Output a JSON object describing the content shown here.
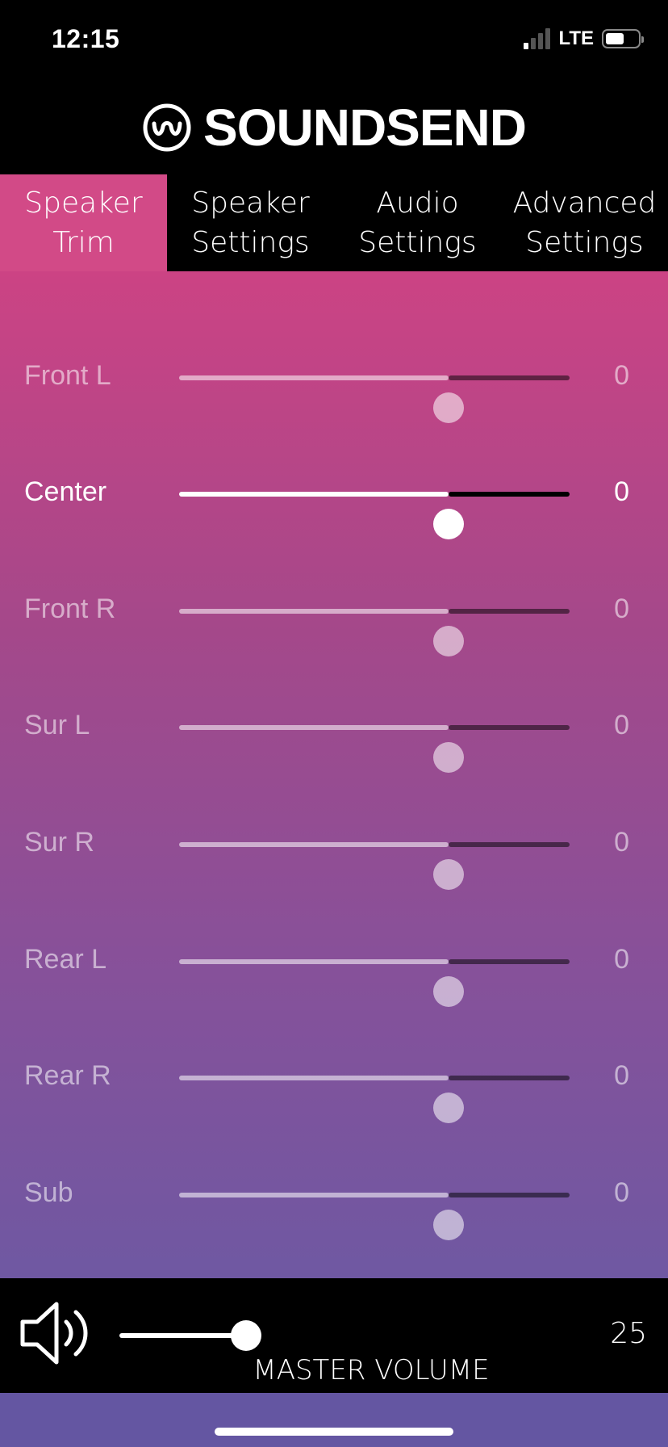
{
  "status_bar": {
    "time": "12:15",
    "network": "LTE",
    "signal_bars": 1,
    "battery_level": 0.5
  },
  "app": {
    "logo_text": "SOUNDSEND",
    "icon": "wave-circle-icon"
  },
  "tabs": [
    {
      "label": "Speaker\nTrim",
      "active": true
    },
    {
      "label": "Speaker\nSettings",
      "active": false
    },
    {
      "label": "Audio\nSettings",
      "active": false
    },
    {
      "label": "Advanced\nSettings",
      "active": false
    }
  ],
  "trims": [
    {
      "label": "Front L",
      "value": "0",
      "level": 0.69,
      "selected": false
    },
    {
      "label": "Center",
      "value": "0",
      "level": 0.69,
      "selected": true
    },
    {
      "label": "Front R",
      "value": "0",
      "level": 0.69,
      "selected": false
    },
    {
      "label": "Sur L",
      "value": "0",
      "level": 0.69,
      "selected": false
    },
    {
      "label": "Sur R",
      "value": "0",
      "level": 0.69,
      "selected": false
    },
    {
      "label": "Rear L",
      "value": "0",
      "level": 0.69,
      "selected": false
    },
    {
      "label": "Rear R",
      "value": "0",
      "level": 0.69,
      "selected": false
    },
    {
      "label": "Sub",
      "value": "0",
      "level": 0.69,
      "selected": false
    }
  ],
  "master_volume": {
    "label": "MASTER VOLUME",
    "value": "25",
    "icon": "speaker-volume-icon"
  },
  "colors": {
    "active_tab": "#d24a87",
    "panel_top": "#cc4384",
    "panel_bottom": "#6f58a2"
  }
}
